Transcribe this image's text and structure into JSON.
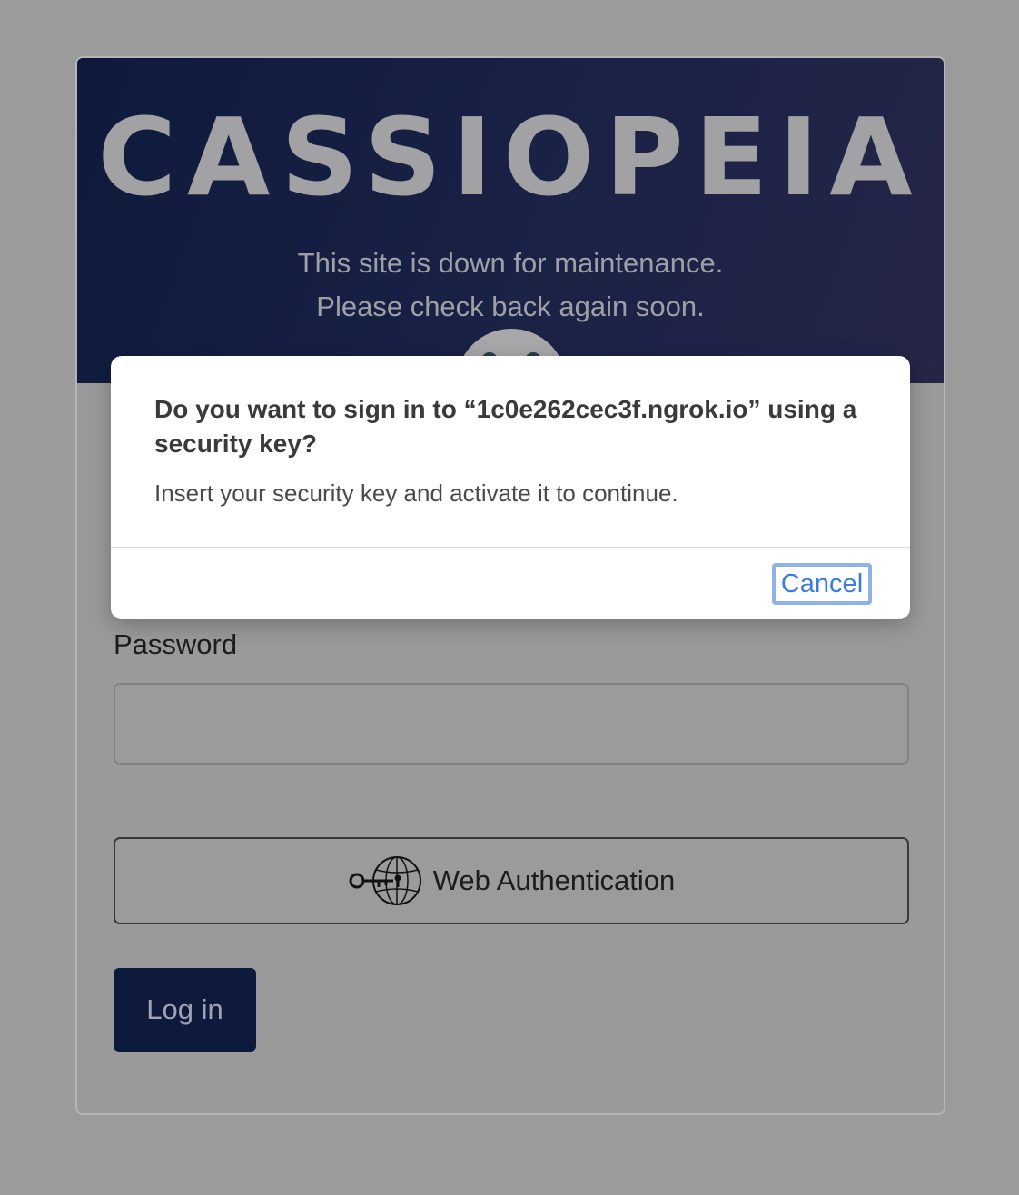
{
  "header": {
    "brand": "CASSIOPEIA",
    "offline_line1": "This site is down for maintenance.",
    "offline_line2": "Please check back again soon."
  },
  "form": {
    "password_label": "Password",
    "password_value": "",
    "webauthn_label": "Web Authentication",
    "login_label": "Log in"
  },
  "dialog": {
    "title": "Do you want to sign in to “1c0e262cec3f.ngrok.io” using a security key?",
    "message": "Insert your security key and activate it to continue.",
    "cancel_label": "Cancel"
  },
  "icons": {
    "webauthn": "key-globe-icon",
    "logo": "logo-icon"
  },
  "colors": {
    "header_bg": "#0e1a3c",
    "login_button": "#0e1a3c",
    "cancel_text": "#3b7be0",
    "focus_ring": "#8fb1ee"
  }
}
